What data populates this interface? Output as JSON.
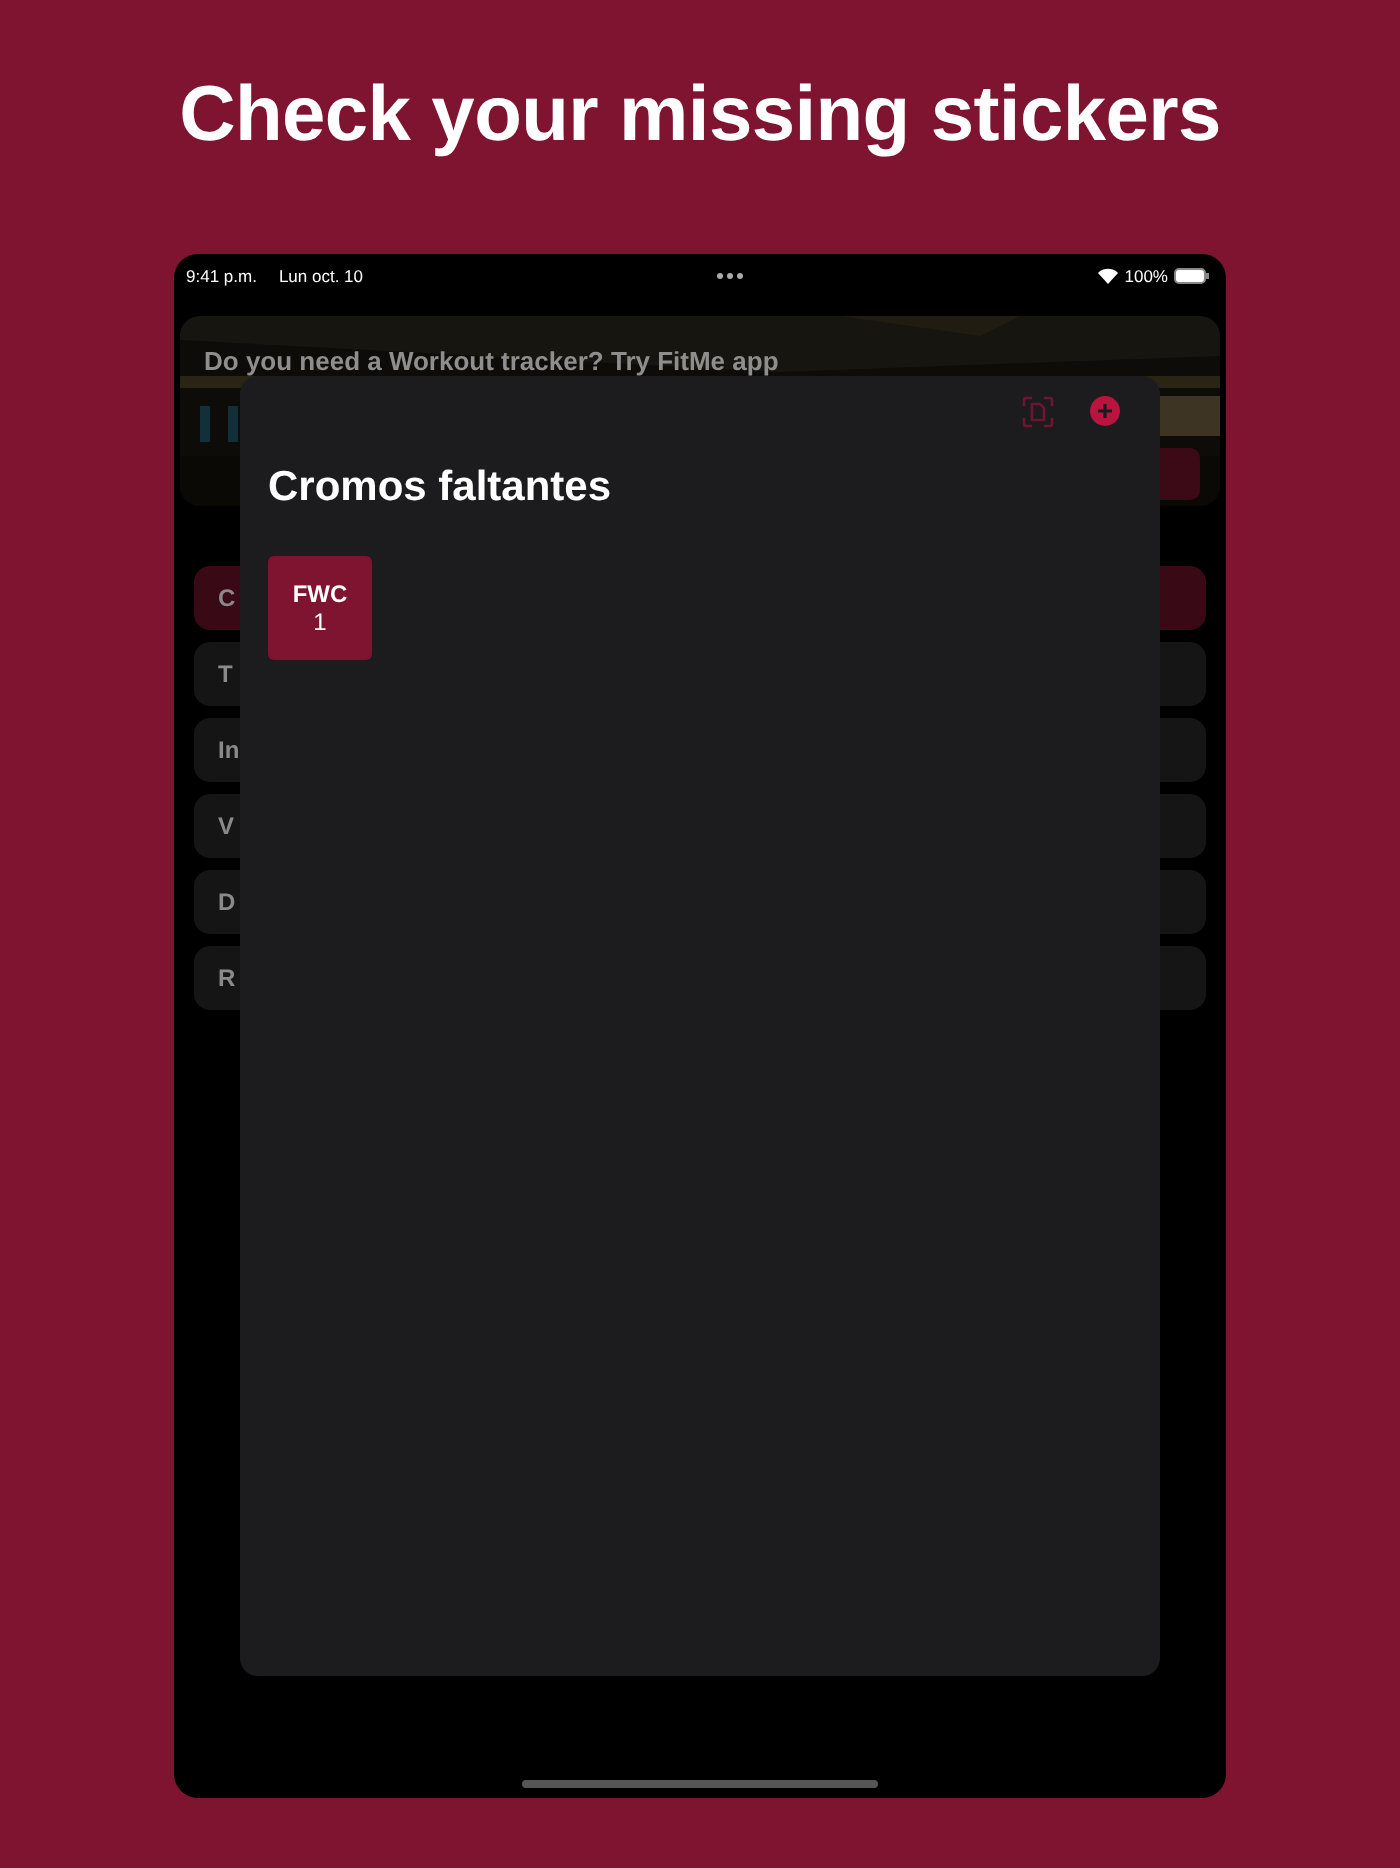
{
  "headline": "Check your missing stickers",
  "status_bar": {
    "time": "9:41 p.m.",
    "date": "Lun oct. 10",
    "battery": "100%"
  },
  "banner": {
    "text": "Do you need a Workout tracker? Try FitMe app"
  },
  "menu_items": [
    {
      "label": "C",
      "selected": true
    },
    {
      "label": "T",
      "selected": false
    },
    {
      "label": "In",
      "selected": false
    },
    {
      "label": "V",
      "selected": false
    },
    {
      "label": "D",
      "selected": false
    },
    {
      "label": "R",
      "selected": false
    }
  ],
  "sheet": {
    "title": "Cromos faltantes",
    "stickers": [
      {
        "code": "FWC",
        "number": "1"
      }
    ]
  }
}
